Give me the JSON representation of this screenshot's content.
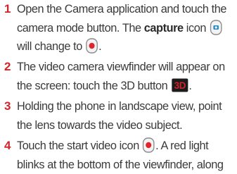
{
  "steps": [
    {
      "number": "1",
      "line1": "Open the Camera application and touch the",
      "line2_before": "camera mode button. The ",
      "line2_bold": "capture",
      "line2_after": " icon",
      "line3_before": "will change to",
      "line3_after": "."
    },
    {
      "number": "2",
      "line1": "The video camera viewfinder will appear on",
      "line2_before": "the screen: touch the 3D button",
      "line2_after": ".",
      "icon_3d_label": "3D"
    },
    {
      "number": "3",
      "line1": "Holding the phone in landscape view, point",
      "line2": "the lens towards the video subject."
    },
    {
      "number": "4",
      "line1_before": "Touch the start video icon",
      "line1_after": ". A red light",
      "line2": "blinks at the bottom of the viewfinder, along"
    }
  ],
  "icons": {
    "capture": "camera-capture-icon",
    "video": "video-record-icon",
    "three_d": "3d-button-icon",
    "start_video": "start-video-icon"
  },
  "colors": {
    "number": "#d2232a",
    "text": "#3a3a3a",
    "record_dot": "#e0262b",
    "capture_blue": "#2a8fc6"
  }
}
